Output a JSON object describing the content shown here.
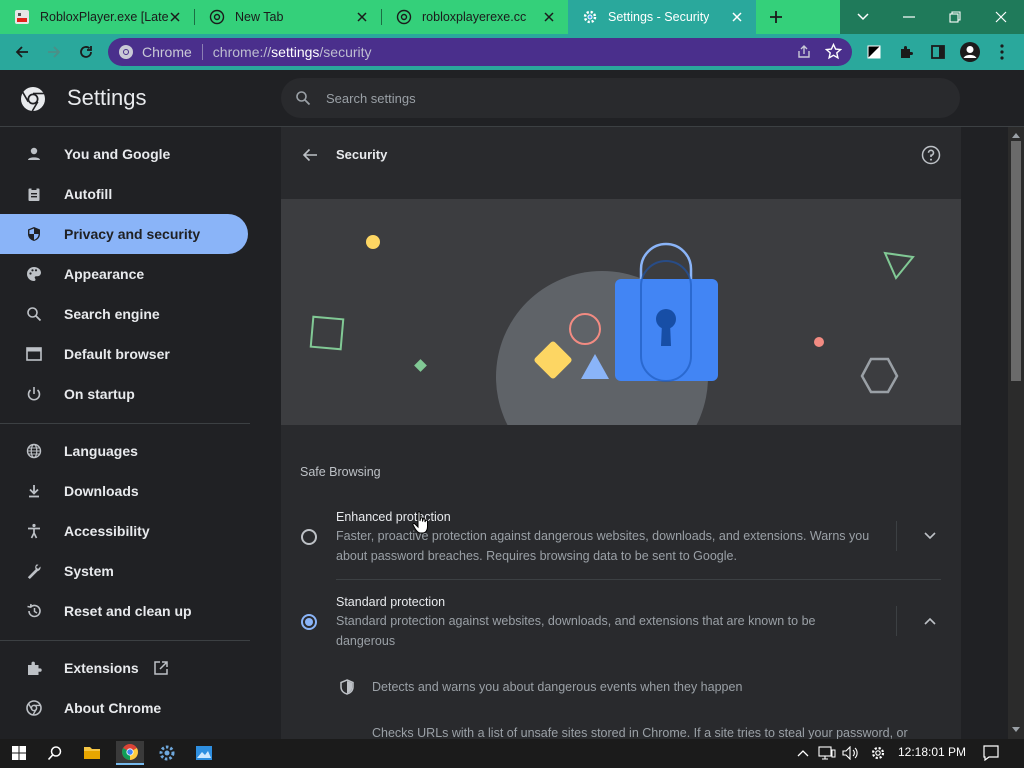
{
  "tabs": [
    {
      "title": "RobloxPlayer.exe [Late",
      "favicon": "roblox-icon"
    },
    {
      "title": "New Tab",
      "favicon": "globe-icon"
    },
    {
      "title": "robloxplayerexe.cc",
      "favicon": "globe-icon"
    },
    {
      "title": "Settings - Security",
      "favicon": "gear-icon",
      "active": true
    }
  ],
  "omnibox": {
    "site": "Chrome",
    "url_prefix": "chrome://",
    "url_host": "settings",
    "url_path": "/security"
  },
  "header": {
    "title": "Settings",
    "search_placeholder": "Search settings"
  },
  "sidebar": {
    "items": [
      {
        "label": "You and Google",
        "icon": "person-icon"
      },
      {
        "label": "Autofill",
        "icon": "clipboard-icon"
      },
      {
        "label": "Privacy and security",
        "icon": "shield-icon",
        "selected": true
      },
      {
        "label": "Appearance",
        "icon": "palette-icon"
      },
      {
        "label": "Search engine",
        "icon": "search-icon"
      },
      {
        "label": "Default browser",
        "icon": "browser-icon"
      },
      {
        "label": "On startup",
        "icon": "power-icon"
      },
      {
        "label": "Languages",
        "icon": "globe-icon"
      },
      {
        "label": "Downloads",
        "icon": "download-icon"
      },
      {
        "label": "Accessibility",
        "icon": "accessibility-icon"
      },
      {
        "label": "System",
        "icon": "wrench-icon"
      },
      {
        "label": "Reset and clean up",
        "icon": "restore-icon"
      },
      {
        "label": "Extensions",
        "icon": "puzzle-icon"
      },
      {
        "label": "About Chrome",
        "icon": "chrome-icon"
      }
    ]
  },
  "page": {
    "title": "Security",
    "section": "Safe Browsing",
    "options": [
      {
        "label": "Enhanced protection",
        "desc": "Faster, proactive protection against dangerous websites, downloads, and extensions. Warns you about password breaches. Requires browsing data to be sent to Google.",
        "selected": false
      },
      {
        "label": "Standard protection",
        "desc": "Standard protection against websites, downloads, and extensions that are known to be dangerous",
        "selected": true
      }
    ],
    "details": [
      "Detects and warns you about dangerous events when they happen",
      "Checks URLs with a list of unsafe sites stored in Chrome. If a site tries to steal your password, or"
    ]
  },
  "taskbar": {
    "time": "12:18:01 PM"
  },
  "colors": {
    "tabstrip": "#34d07a",
    "toolbar": "#2aa89c",
    "omnibox": "#4a2f8c",
    "accent": "#8ab4f8",
    "background": "#202124",
    "card": "#292a2d"
  }
}
